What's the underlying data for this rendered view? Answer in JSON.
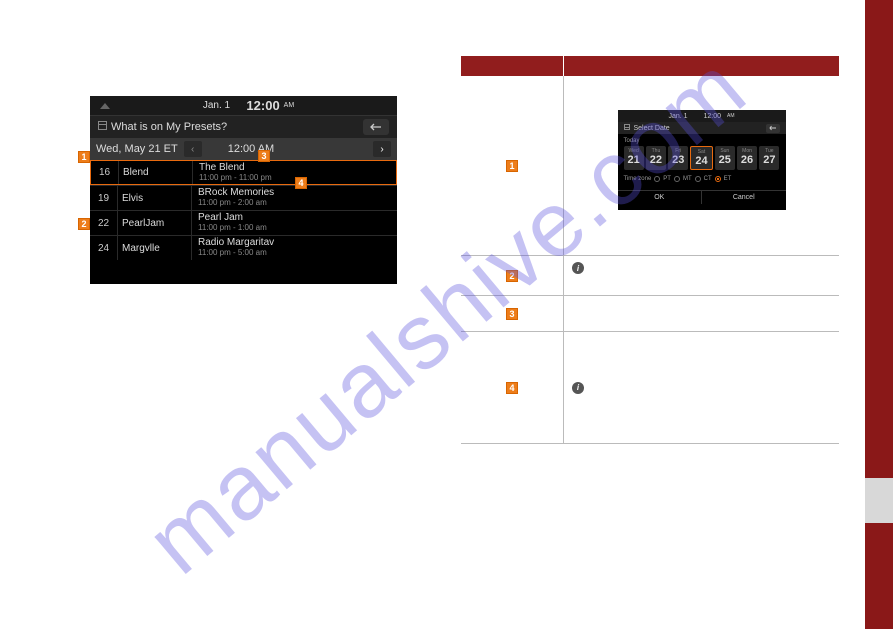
{
  "watermark": "manualshive.com",
  "screenshot": {
    "topbar": {
      "date": "Jan.  1",
      "time": "12:00",
      "ampm": "AM"
    },
    "title": "What is on My Presets?",
    "dateRow": {
      "date": "Wed, May 21 ET",
      "time": "12:00 AM"
    },
    "rows": [
      {
        "num": "16",
        "channel": "Blend",
        "program": "The Blend",
        "timespan": "11:00 pm - 11:00 pm",
        "selected": true
      },
      {
        "num": "19",
        "channel": "Elvis",
        "program": "BRock Memories",
        "timespan": "11:00 pm - 2:00 am",
        "selected": false
      },
      {
        "num": "22",
        "channel": "PearlJam",
        "program": "Pearl Jam",
        "timespan": "11:00 pm - 1:00 am",
        "selected": false
      },
      {
        "num": "24",
        "channel": "Margvlle",
        "program": "Radio Margaritav",
        "timespan": "11:00 pm - 5:00 am",
        "selected": false
      }
    ]
  },
  "selectDate": {
    "topbar": {
      "date": "Jan.  1",
      "time": "12:00",
      "ampm": "AM"
    },
    "title": "Select Date",
    "todayLabel": "Today",
    "days": [
      {
        "dow": "Wed",
        "num": "21",
        "sel": false
      },
      {
        "dow": "Thu",
        "num": "22",
        "sel": false
      },
      {
        "dow": "Fri",
        "num": "23",
        "sel": false
      },
      {
        "dow": "Sat",
        "num": "24",
        "sel": true
      },
      {
        "dow": "Sun",
        "num": "25",
        "sel": false
      },
      {
        "dow": "Mon",
        "num": "26",
        "sel": false
      },
      {
        "dow": "Tue",
        "num": "27",
        "sel": false
      }
    ],
    "timezoneLabel": "Time zone",
    "timezones": [
      {
        "label": "PT",
        "on": false
      },
      {
        "label": "MT",
        "on": false
      },
      {
        "label": "CT",
        "on": false
      },
      {
        "label": "ET",
        "on": true
      }
    ],
    "ok": "OK",
    "cancel": "Cancel"
  },
  "markers": {
    "m1": "1",
    "m2": "2",
    "m3": "3",
    "m4": "4"
  },
  "info": "i"
}
